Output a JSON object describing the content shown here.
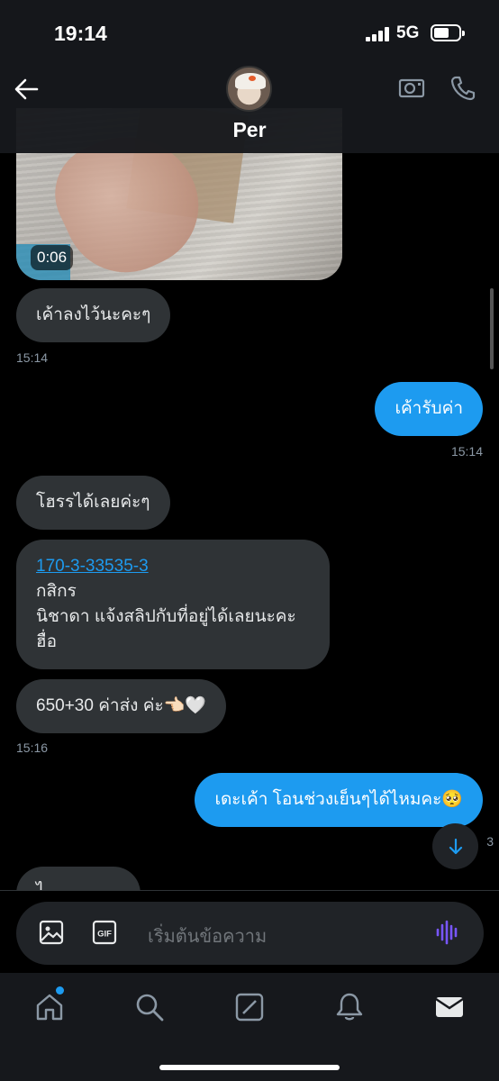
{
  "status_bar": {
    "time": "19:14",
    "network": "5G"
  },
  "header": {
    "contact_name": "Per"
  },
  "messages": {
    "video_duration": "0:06",
    "m1": "เค้าลงไว้นะคะๆ",
    "t1": "15:14",
    "m2": "เค้ารับค่า",
    "t2": "15:14",
    "m3": "โฮรรได้เลยค่ะๆ",
    "m4_link": "170-3-33535-3",
    "m4_line2": "กสิกร",
    "m4_line3": "นิชาดา แจ้งสลิปกับที่อยู่ได้เลยนะคะ",
    "m4_line4": "ฮื่อ",
    "m5": "650+30 ค่าส่ง ค่ะ👈🏻🤍",
    "t5": "15:16",
    "m6": "เดะเค้า โอนช่วงเย็นๆได้ไหมคะ🥺",
    "t6": "3",
    "m7_partial": "ไ..."
  },
  "composer": {
    "placeholder": "เริ่มต้นข้อความ",
    "gif_label": "GIF"
  }
}
